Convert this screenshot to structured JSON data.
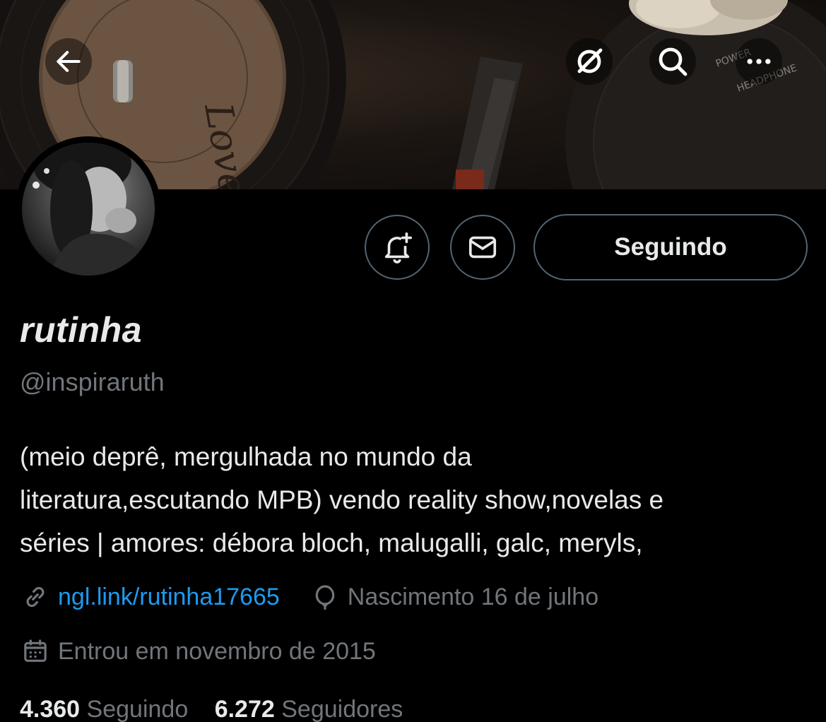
{
  "header": {
    "back_icon": "arrow-left-icon",
    "translate_icon": "grok-slash-icon",
    "search_icon": "search-icon",
    "more_icon": "more-horizontal-icon"
  },
  "profile": {
    "display_name": "rutinha",
    "handle": "@inspiraruth",
    "bio_lines": [
      "(meio deprê, mergulhada no mundo da",
      "literatura,escutando MPB) vendo reality show,novelas e",
      "séries | amores: débora bloch, malugalli, galc, meryls,"
    ],
    "link": "ngl.link/rutinha17665",
    "birthday": "Nascimento 16 de julho",
    "joined": "Entrou em novembro de 2015"
  },
  "actions": {
    "follow_label": "Seguindo"
  },
  "stats": {
    "following_count": "4.360",
    "following_label": "Seguindo",
    "followers_count": "6.272",
    "followers_label": "Seguidores"
  },
  "colors": {
    "background": "#000000",
    "text": "#e7e9ea",
    "muted": "#71767b",
    "link": "#1d9bf0",
    "border": "#536471"
  }
}
